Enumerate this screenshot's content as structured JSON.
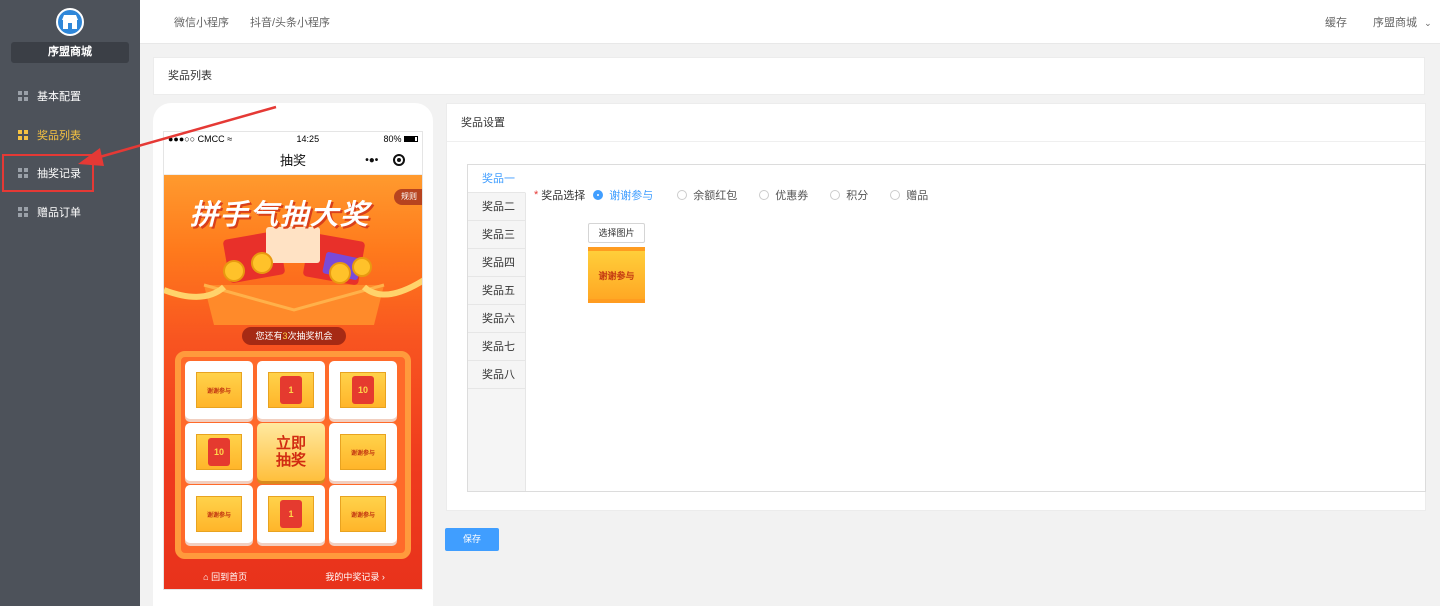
{
  "sidebar": {
    "store_name": "序盟商城",
    "items": [
      {
        "label": "基本配置",
        "icon": "grid-icon"
      },
      {
        "label": "奖品列表",
        "icon": "grid-icon"
      },
      {
        "label": "抽奖记录",
        "icon": "grid-icon"
      },
      {
        "label": "赠品订单",
        "icon": "grid-icon"
      }
    ],
    "active_color": "#f5c242"
  },
  "topbar": {
    "tabs": [
      "微信小程序",
      "抖音/头条小程序"
    ],
    "cache": "缓存",
    "store": "序盟商城"
  },
  "page": {
    "title": "奖品列表"
  },
  "phone": {
    "carrier": "●●●○○ CMCC",
    "time": "14:25",
    "battery": "80%",
    "nav_title": "抽奖",
    "hero_title": "拼手气抽大奖",
    "rule": "规则",
    "chance_prefix": "您还有",
    "chance_num": "3",
    "chance_suffix": "次抽奖机会",
    "cells": [
      {
        "type": "thanks",
        "text": "谢谢参与"
      },
      {
        "type": "redpack",
        "text": "1"
      },
      {
        "type": "redpack",
        "text": "10"
      },
      {
        "type": "redpack",
        "text": "10"
      },
      {
        "type": "center",
        "text1": "立即",
        "text2": "抽奖"
      },
      {
        "type": "thanks",
        "text": "谢谢参与"
      },
      {
        "type": "thanks",
        "text": "谢谢参与"
      },
      {
        "type": "redpack",
        "text": "1"
      },
      {
        "type": "thanks",
        "text": "谢谢参与"
      }
    ],
    "home": "回到首页",
    "my_records": "我的中奖记录"
  },
  "settings": {
    "title": "奖品设置",
    "tabs": [
      "奖品一",
      "奖品二",
      "奖品三",
      "奖品四",
      "奖品五",
      "奖品六",
      "奖品七",
      "奖品八"
    ],
    "field_label": "奖品选择",
    "options": [
      "谢谢参与",
      "余额红包",
      "优惠券",
      "积分",
      "赠品"
    ],
    "selected": "谢谢参与",
    "pick_image": "选择图片",
    "image_text": "谢谢参与"
  },
  "save_label": "保存",
  "colors": {
    "primary": "#409eff",
    "sidebar": "#4d525a",
    "annotation": "#e53935"
  }
}
